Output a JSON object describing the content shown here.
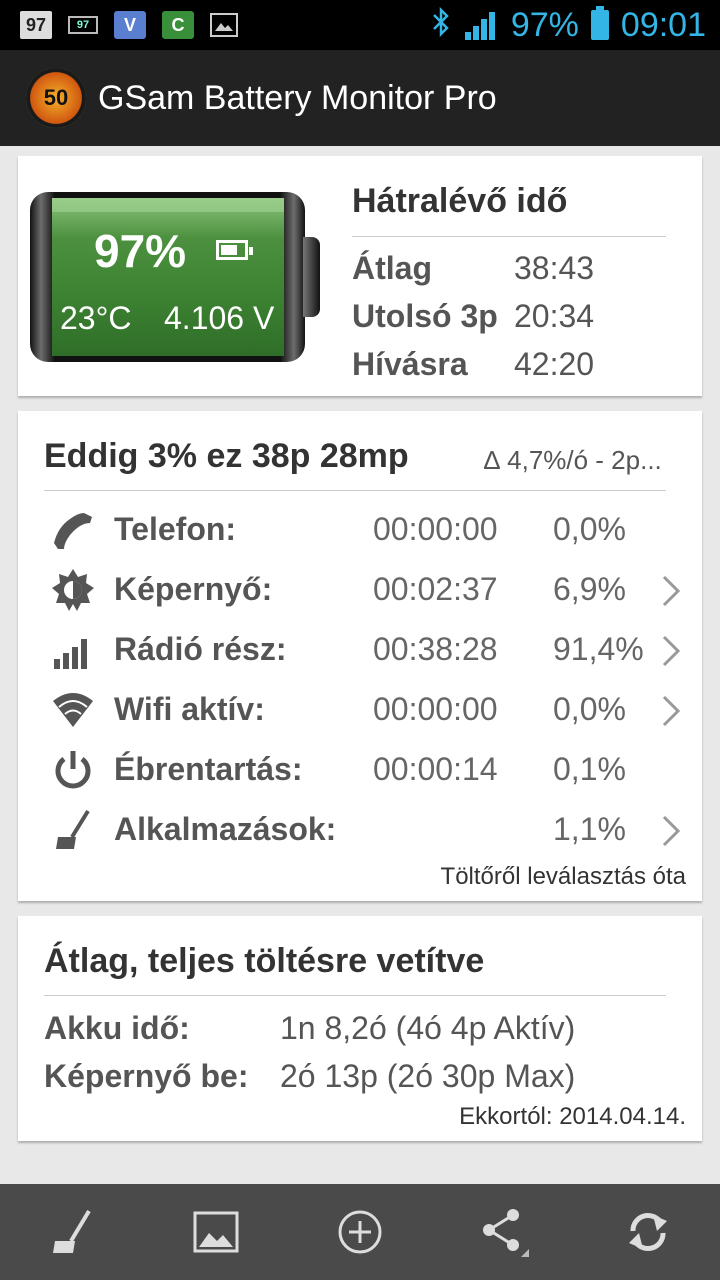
{
  "status_bar": {
    "notif_97": "97",
    "notif_batt": "97",
    "notif_v": "V",
    "notif_c": "C",
    "battery_pct": "97%",
    "time": "09:01"
  },
  "app": {
    "icon_value": "50",
    "title": "GSam Battery Monitor Pro"
  },
  "battery": {
    "percent": "97%",
    "temp": "23°C",
    "voltage": "4.106 V"
  },
  "remaining": {
    "title": "Hátralévő idő",
    "rows": [
      {
        "label": "Átlag",
        "value": "38:43"
      },
      {
        "label": "Utolsó 3p",
        "value": "20:34"
      },
      {
        "label": "Hívásra",
        "value": "42:20"
      }
    ]
  },
  "usage": {
    "title": "Eddig 3% ez 38p 28mp",
    "delta": "∆ 4,7%/ó - 2p...",
    "rows": [
      {
        "icon": "phone-icon",
        "name": "Telefon:",
        "time": "00:00:00",
        "pct": "0,0%",
        "chevron": false
      },
      {
        "icon": "brightness-icon",
        "name": "Képernyő:",
        "time": "00:02:37",
        "pct": "6,9%",
        "chevron": true
      },
      {
        "icon": "signal-icon",
        "name": "Rádió rész:",
        "time": "00:38:28",
        "pct": "91,4%",
        "chevron": true
      },
      {
        "icon": "wifi-icon",
        "name": "Wifi aktív:",
        "time": "00:00:00",
        "pct": "0,0%",
        "chevron": true
      },
      {
        "icon": "power-icon",
        "name": "Ébrentartás:",
        "time": "00:00:14",
        "pct": "0,1%",
        "chevron": false
      },
      {
        "icon": "broom-icon",
        "name": "Alkalmazások:",
        "time": "",
        "pct": "1,1%",
        "chevron": true
      }
    ],
    "footer": "Töltőről leválasztás óta"
  },
  "average": {
    "title": "Átlag, teljes töltésre vetítve",
    "rows": [
      {
        "label": "Akku idő:",
        "value": "1n 8,2ó (4ó 4p Aktív)"
      },
      {
        "label": "Képernyő be:",
        "value": "2ó 13p (2ó 30p Max)"
      }
    ],
    "footer": "Ekkortól: 2014.04.14."
  },
  "bottom_bar": [
    "broom-icon",
    "picture-icon",
    "add-icon",
    "share-icon",
    "refresh-icon"
  ],
  "colors": {
    "accent": "#33b5e5",
    "battery_green": "#3f8534",
    "action_bar": "#222222",
    "bottom_bar": "#4a4a4a"
  }
}
